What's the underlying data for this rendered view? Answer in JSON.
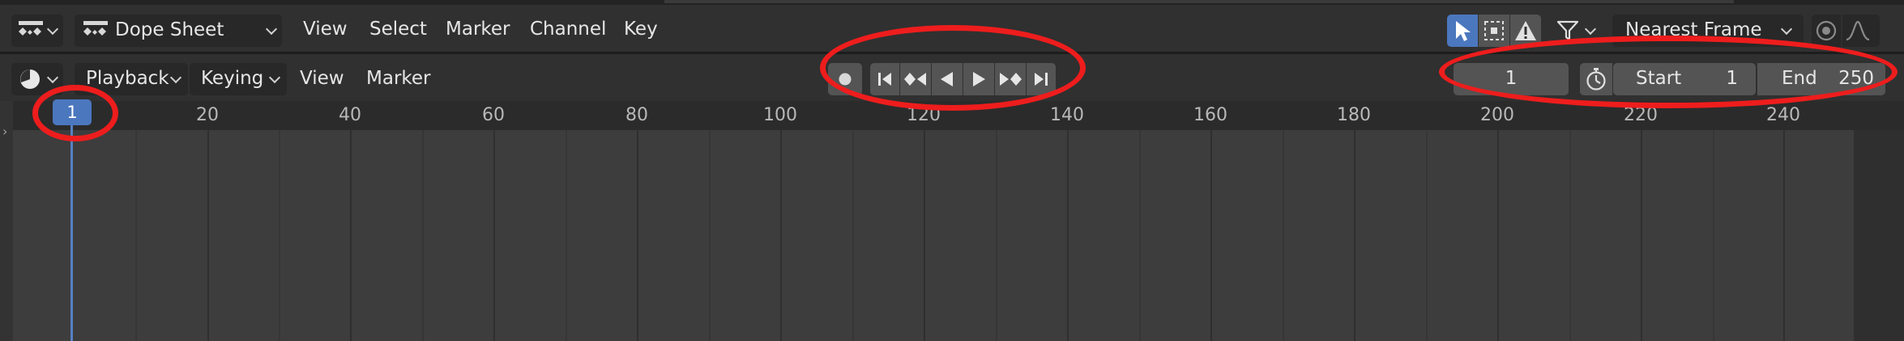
{
  "header": {
    "editor_mode": "Dope Sheet",
    "menus": [
      "View",
      "Select",
      "Marker",
      "Channel",
      "Key"
    ],
    "snapping": "Nearest Frame",
    "icons": {
      "editor_type": "dope-sheet-icon",
      "select_mode": "arrow-cursor-icon",
      "box_select": "box-select-icon",
      "warning": "warning-icon",
      "filter": "funnel-icon",
      "proportional": "proportional-edit-icon",
      "falloff": "falloff-curve-icon"
    }
  },
  "timeline_header": {
    "playback_label": "Playback",
    "keying_label": "Keying",
    "menus": [
      "View",
      "Marker"
    ],
    "current_frame": "1",
    "start_label": "Start",
    "start_value": "1",
    "end_label": "End",
    "end_value": "250",
    "transport_icons": [
      "record-icon",
      "jump-to-start-icon",
      "jump-to-prev-keyframe-icon",
      "play-reverse-icon",
      "play-icon",
      "jump-to-next-keyframe-icon",
      "jump-to-end-icon"
    ],
    "stopwatch_icon": "stopwatch-icon"
  },
  "ruler": {
    "labels": [
      "20",
      "40",
      "60",
      "80",
      "100",
      "120",
      "140",
      "160",
      "180",
      "200",
      "220",
      "240"
    ],
    "playhead_frame": "1"
  },
  "colors": {
    "accent": "#4b77be",
    "annotation": "#ee1d1d"
  }
}
